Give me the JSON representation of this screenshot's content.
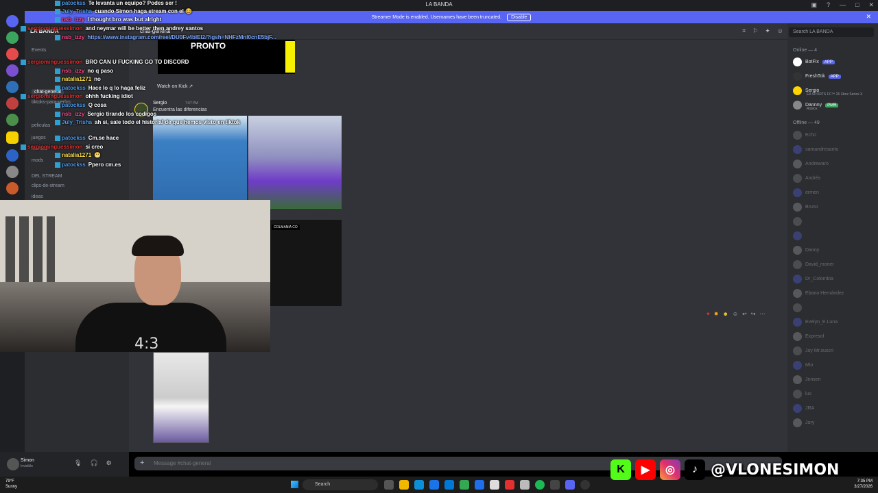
{
  "window": {
    "title": "LA BANDA"
  },
  "banner": {
    "text": "Streamer Mode is enabled. Usernames have been truncated.",
    "disable_label": "Disable"
  },
  "server": {
    "name": "LA BANDA",
    "channels": [
      "Events",
      "chat-general",
      "tiktoks-para-verlos",
      "peliculas",
      "juegos",
      "memes",
      "mods",
      "DEL STREAM",
      "clips-de-stream",
      "ideas"
    ]
  },
  "header": {
    "channel": "chat-general",
    "search_placeholder": "Search LA BANDA"
  },
  "members": {
    "online_header": "Online — 4",
    "offline_header": "Offline — 49",
    "online": [
      {
        "name": "BotFix",
        "badge": "APP"
      },
      {
        "name": "FreshTok",
        "badge": "APP"
      },
      {
        "name": "Sergio",
        "sub": "EA SPORTS FC™ 26 Xbox Series X"
      },
      {
        "name": "Dannny",
        "badge": "PMR",
        "sub": "Roblox"
      }
    ],
    "offline": [
      "Echo",
      "samandresanto",
      "Andrewaro",
      "Andrés",
      "ermen",
      "Bruno",
      "",
      "",
      "Danny",
      "David_moner",
      "Dr_Colombia",
      "Ebano Hernández",
      "",
      "Evelyn_E.Luna",
      "Expresol",
      "Joy Mr.suscri",
      "Mio",
      "Jensen",
      "lus",
      "JRA",
      "Jory"
    ]
  },
  "message": {
    "embed_title": "PRONTO",
    "watch_label": "Watch on Kick",
    "author": "Sergio",
    "time": "7:07 PM",
    "text": "Encuentra las diferencias",
    "video_label": "COLMANIA CO"
  },
  "composer": {
    "placeholder": "Message #chat-general"
  },
  "user": {
    "name": "Simon",
    "status": "Invisible"
  },
  "taskbar": {
    "weather_temp": "79°F",
    "weather_desc": "Sunny",
    "search": "Search",
    "time": "7:35 PM",
    "date": "3/27/2026"
  },
  "chat": [
    {
      "user": "patockss",
      "color": "#4f9cf0",
      "text": "Te levanta un equipo? Podes ser !"
    },
    {
      "user": "July_Trisha",
      "color": "#4f9cf0",
      "text": "cuando Simon haga stream con el 😂"
    },
    {
      "user": "nsb_izzy",
      "color": "#ff4d8a",
      "text": "I thought bro was but alright"
    },
    {
      "user": "sergiominguessimon",
      "color": "#e03030",
      "text": "and neymar will be better then andrey santos"
    },
    {
      "user": "nsb_izzy",
      "color": "#ff4d8a",
      "text": "https://www.instagram.com/reel/DU0Fv4bIEl2/?igsh=NHFzMnI0cnE5bjF..."
    },
    {
      "user": "sergiominguessimon",
      "color": "#e03030",
      "text": "BRO CAN U FUCKING GO TO DISCORD"
    },
    {
      "user": "nsb_izzy",
      "color": "#ff4d8a",
      "text": "no q paso"
    },
    {
      "user": "natalia1271",
      "color": "#ffe14d",
      "text": "no"
    },
    {
      "user": "patockss",
      "color": "#4f9cf0",
      "text": "Hace lo q lo haga feliz"
    },
    {
      "user": "sergiominguessimon",
      "color": "#e03030",
      "text": "ohhh fucking idiot"
    },
    {
      "user": "patockss",
      "color": "#4f9cf0",
      "text": "Q cosa"
    },
    {
      "user": "nsb_izzy",
      "color": "#ff4d8a",
      "text": "Sergio tirando los codigos"
    },
    {
      "user": "July_Trisha",
      "color": "#4f9cf0",
      "text": "ah si, sale todo el historial de que hemos visto en tiktok"
    },
    {
      "user": "patockss",
      "color": "#4f9cf0",
      "text": "Cm.se hace"
    },
    {
      "user": "sergiominguessimon",
      "color": "#e03030",
      "text": "si creo"
    },
    {
      "user": "natalia1271",
      "color": "#ffe14d",
      "text": "😬"
    },
    {
      "user": "patockss",
      "color": "#4f9cf0",
      "text": "Ppero cm.es"
    }
  ],
  "socials": {
    "handle": "@VLONESIMON",
    "icons": [
      "kick-icon",
      "youtube-icon",
      "instagram-icon",
      "tiktok-icon"
    ]
  },
  "webcam": {
    "shirt_text": "4:3"
  }
}
